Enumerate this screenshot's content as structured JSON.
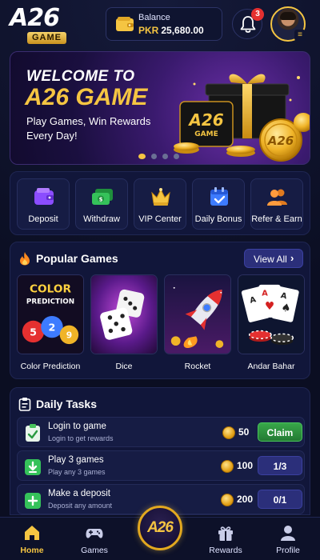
{
  "header": {
    "logo_main": "A26",
    "logo_sub": "GAME",
    "balance_label": "Balance",
    "balance_currency": "PKR",
    "balance_amount": "25,680.00",
    "notification_count": "3"
  },
  "banner": {
    "title_line1": "WELCOME TO",
    "title_line2": "A26 GAME",
    "subtitle": "Play Games, Win Rewards Every Day!",
    "art_logo": "A26",
    "art_logo_sub": "GAME",
    "slide_count": 4,
    "active_slide": 1
  },
  "quick_actions": [
    {
      "label": "Deposit",
      "icon": "wallet-icon"
    },
    {
      "label": "Withdraw",
      "icon": "cash-icon"
    },
    {
      "label": "VIP Center",
      "icon": "crown-icon"
    },
    {
      "label": "Daily Bonus",
      "icon": "calendar-check-icon"
    },
    {
      "label": "Refer & Earn",
      "icon": "users-icon"
    }
  ],
  "popular_games": {
    "title": "Popular Games",
    "view_all": "View All",
    "games": [
      {
        "label": "Color Prediction",
        "art_line1": "COLOR",
        "art_line2": "PREDICTION",
        "balls": [
          "5",
          "2",
          "9"
        ]
      },
      {
        "label": "Dice"
      },
      {
        "label": "Rocket"
      },
      {
        "label": "Andar Bahar"
      }
    ]
  },
  "daily_tasks": {
    "title": "Daily Tasks",
    "tasks": [
      {
        "title": "Login to game",
        "subtitle": "Login to get rewards",
        "reward": "50",
        "action": "Claim"
      },
      {
        "title": "Play 3 games",
        "subtitle": "Play any 3 games",
        "reward": "100",
        "action": "1/3"
      },
      {
        "title": "Make a deposit",
        "subtitle": "Deposit any amount",
        "reward": "200",
        "action": "0/1"
      }
    ]
  },
  "bottom_nav": {
    "items": [
      {
        "label": "Home"
      },
      {
        "label": "Games"
      },
      {
        "label": "Rewards"
      },
      {
        "label": "Profile"
      }
    ],
    "center_label": "A26"
  },
  "colors": {
    "accent_gold": "#f5c542",
    "background": "#0b0e22",
    "claim_green": "#38a84a",
    "progress_blue": "#2b2f7a",
    "badge_red": "#e53030"
  }
}
